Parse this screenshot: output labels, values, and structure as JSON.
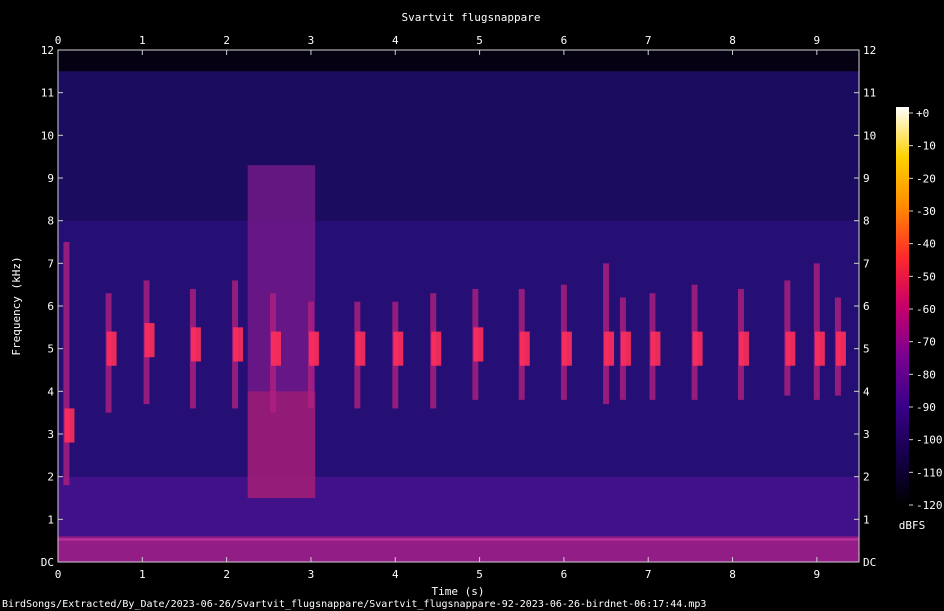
{
  "chart_data": {
    "type": "heatmap",
    "title": "Svartvit flugsnappare",
    "xlabel": "Time (s)",
    "ylabel": "Frequency (kHz)",
    "xlim": [
      0,
      9.5
    ],
    "ylim": [
      0,
      12
    ],
    "x_ticks": [
      "0",
      "1",
      "2",
      "3",
      "4",
      "5",
      "6",
      "7",
      "8",
      "9"
    ],
    "y_ticks": [
      "DC",
      "1",
      "2",
      "3",
      "4",
      "5",
      "6",
      "7",
      "8",
      "9",
      "10",
      "11",
      "12"
    ],
    "colorbar": {
      "label": "dBFS",
      "ticks": [
        "+0",
        "-10",
        "-20",
        "-30",
        "-40",
        "-50",
        "-60",
        "-70",
        "-80",
        "-90",
        "-100",
        "-110",
        "-120"
      ],
      "range": [
        -120,
        0
      ],
      "colors": [
        "#000000",
        "#15004a",
        "#3a0088",
        "#7a0090",
        "#c8006a",
        "#ff2a2a",
        "#ff8a00",
        "#ffd200",
        "#ffffff"
      ]
    },
    "noise_band_khz": [
      0,
      11.5
    ],
    "broadband_burst": {
      "t_start": 2.25,
      "t_end": 3.05,
      "f_low_khz": 1.5,
      "f_high_khz": 9.3
    },
    "song_notes": [
      {
        "t": 0.1,
        "f_low_khz": 1.8,
        "f_high_khz": 7.5,
        "peak_khz": 3.2
      },
      {
        "t": 0.6,
        "f_low_khz": 3.5,
        "f_high_khz": 6.3,
        "peak_khz": 5.0
      },
      {
        "t": 1.05,
        "f_low_khz": 3.7,
        "f_high_khz": 6.6,
        "peak_khz": 5.2
      },
      {
        "t": 1.6,
        "f_low_khz": 3.6,
        "f_high_khz": 6.4,
        "peak_khz": 5.1
      },
      {
        "t": 2.1,
        "f_low_khz": 3.6,
        "f_high_khz": 6.6,
        "peak_khz": 5.1
      },
      {
        "t": 2.55,
        "f_low_khz": 3.5,
        "f_high_khz": 6.3,
        "peak_khz": 5.0
      },
      {
        "t": 3.0,
        "f_low_khz": 3.6,
        "f_high_khz": 6.1,
        "peak_khz": 5.0
      },
      {
        "t": 3.55,
        "f_low_khz": 3.6,
        "f_high_khz": 6.1,
        "peak_khz": 5.0
      },
      {
        "t": 4.0,
        "f_low_khz": 3.6,
        "f_high_khz": 6.1,
        "peak_khz": 5.0
      },
      {
        "t": 4.45,
        "f_low_khz": 3.6,
        "f_high_khz": 6.3,
        "peak_khz": 5.0
      },
      {
        "t": 4.95,
        "f_low_khz": 3.8,
        "f_high_khz": 6.4,
        "peak_khz": 5.1
      },
      {
        "t": 5.5,
        "f_low_khz": 3.8,
        "f_high_khz": 6.4,
        "peak_khz": 5.0
      },
      {
        "t": 6.0,
        "f_low_khz": 3.8,
        "f_high_khz": 6.5,
        "peak_khz": 5.0
      },
      {
        "t": 6.5,
        "f_low_khz": 3.7,
        "f_high_khz": 7.0,
        "peak_khz": 5.0
      },
      {
        "t": 6.7,
        "f_low_khz": 3.8,
        "f_high_khz": 6.2,
        "peak_khz": 5.0
      },
      {
        "t": 7.05,
        "f_low_khz": 3.8,
        "f_high_khz": 6.3,
        "peak_khz": 5.0
      },
      {
        "t": 7.55,
        "f_low_khz": 3.8,
        "f_high_khz": 6.5,
        "peak_khz": 5.0
      },
      {
        "t": 8.1,
        "f_low_khz": 3.8,
        "f_high_khz": 6.4,
        "peak_khz": 5.0
      },
      {
        "t": 8.65,
        "f_low_khz": 3.9,
        "f_high_khz": 6.6,
        "peak_khz": 5.0
      },
      {
        "t": 9.0,
        "f_low_khz": 3.8,
        "f_high_khz": 7.0,
        "peak_khz": 5.0
      },
      {
        "t": 9.25,
        "f_low_khz": 3.9,
        "f_high_khz": 6.2,
        "peak_khz": 5.0
      }
    ]
  },
  "footer": {
    "path": "BirdSongs/Extracted/By_Date/2023-06-26/Svartvit_flugsnappare/Svartvit_flugsnappare-92-2023-06-26-birdnet-06:17:44.mp3"
  }
}
